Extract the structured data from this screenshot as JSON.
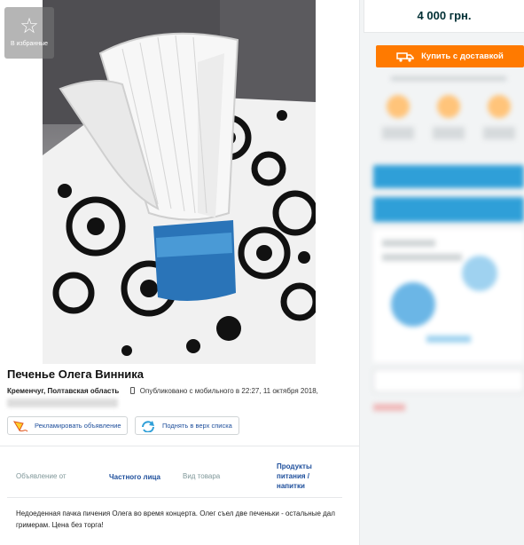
{
  "gallery": {
    "favorite_label": "В избранные"
  },
  "listing": {
    "title": "Печенье Олега Винника",
    "location": "Кременчуг, Полтавская область",
    "published": "Опубликовано с мобильного",
    "published_at": "в 22:27, 11 октября 2018,"
  },
  "actions": {
    "advertise_label": "Рекламировать объявление",
    "raise_label": "Поднять в верх списка"
  },
  "details": {
    "seller_label": "Объявление от",
    "seller_value": "Частного лица",
    "type_label": "Вид товара",
    "type_value_lines": [
      "Продукты",
      "питания /",
      "напитки"
    ]
  },
  "description": "Недоеденная пачка пичения Олега во время концерта. Олег съел две печеньки - остальные дал гримерам. Цена без торга!",
  "sidebar": {
    "price": "4 000 грн.",
    "buy_label": "Купить с доставкой"
  },
  "colors": {
    "accent_orange": "#ff7a00",
    "link_blue": "#1d4e9b",
    "sidebar_blue": "#2f9fd8",
    "text_dark": "#002f34"
  }
}
